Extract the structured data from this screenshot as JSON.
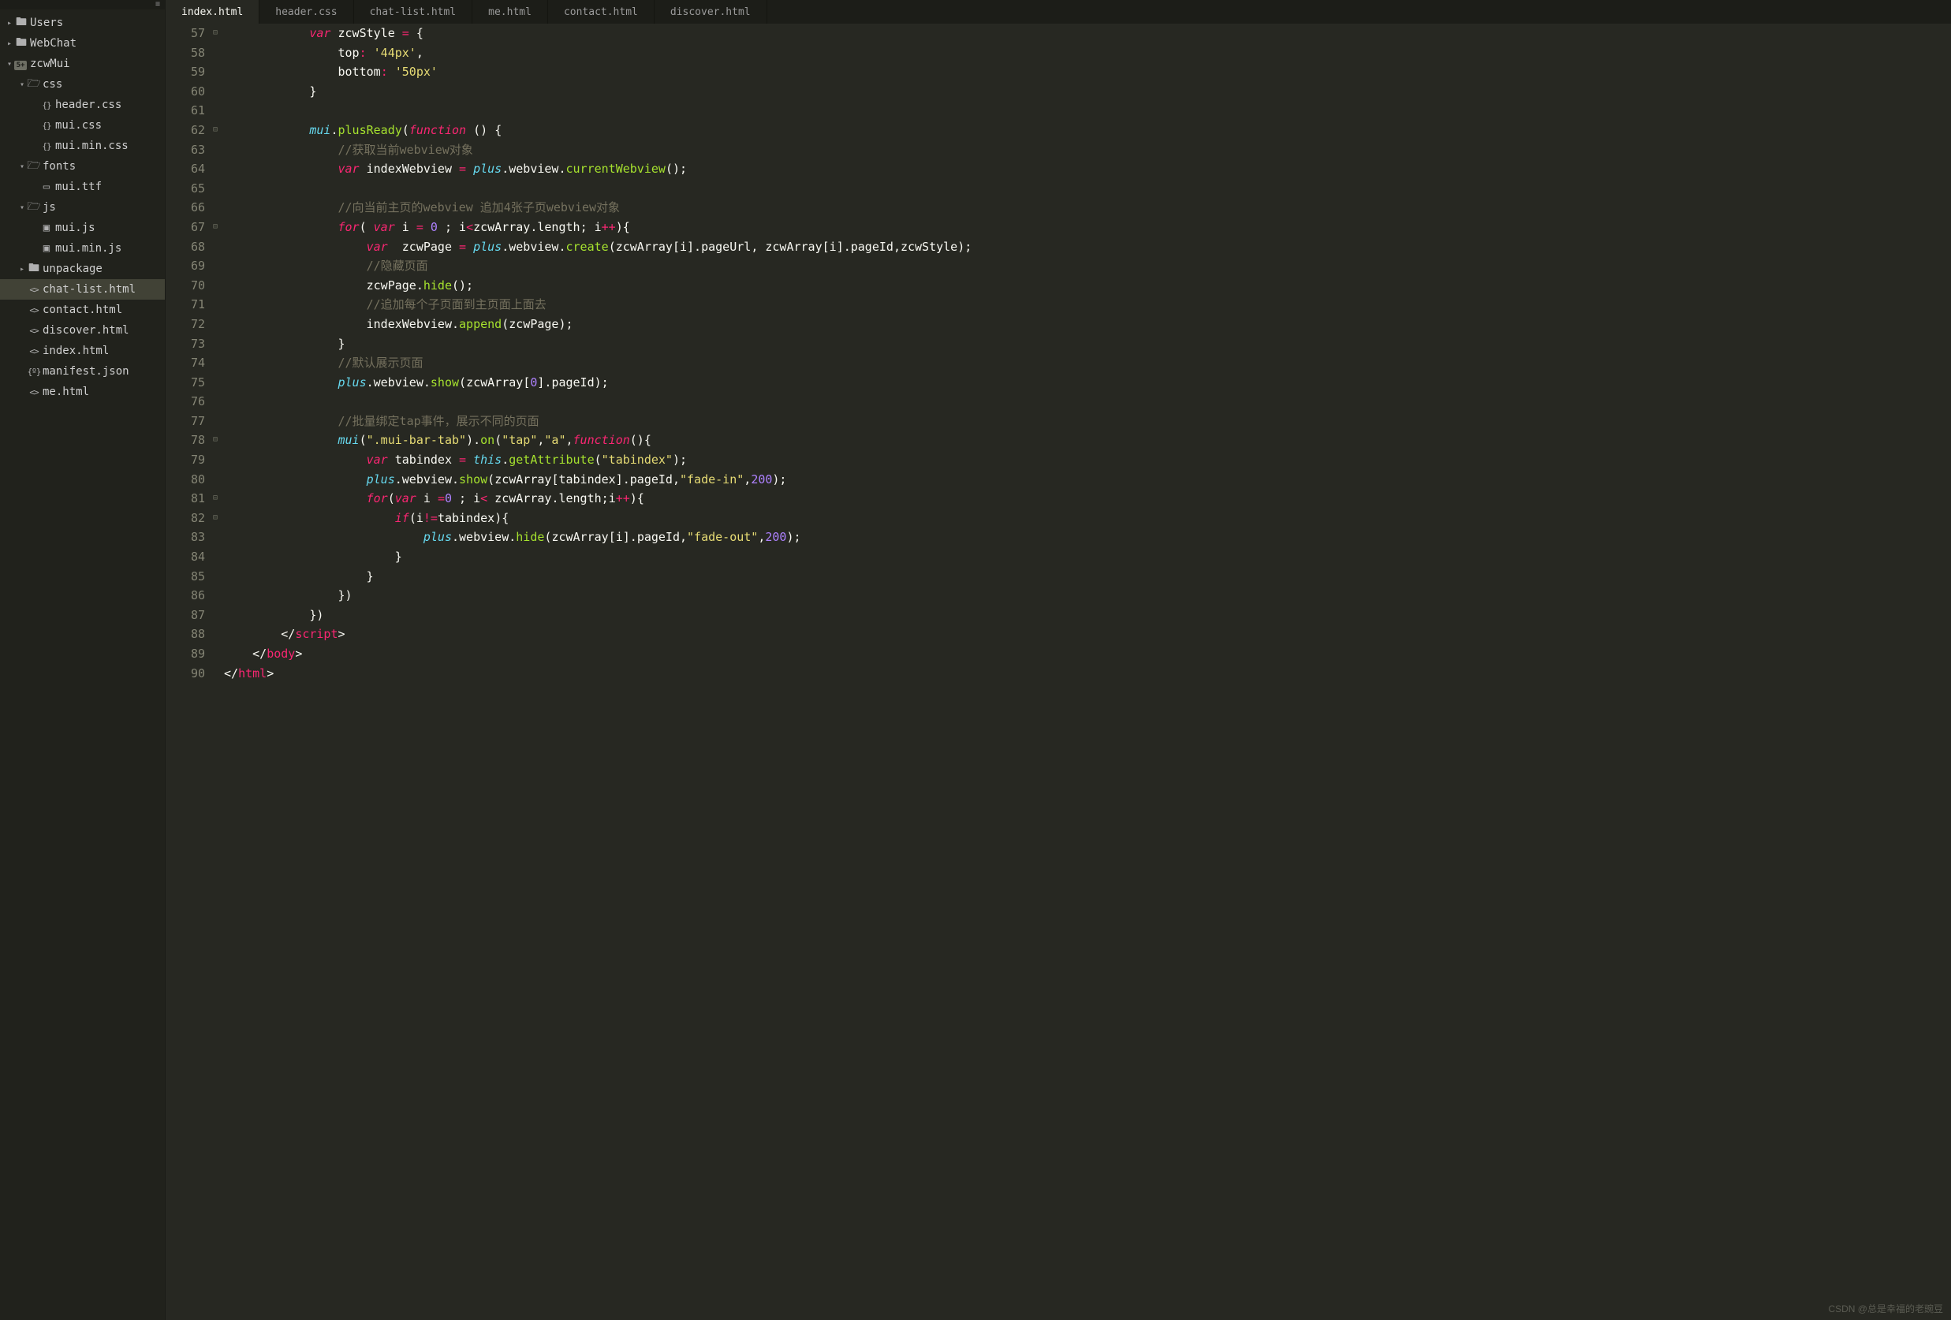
{
  "tabs": [
    {
      "label": "index.html",
      "active": true
    },
    {
      "label": "header.css",
      "active": false
    },
    {
      "label": "chat-list.html",
      "active": false
    },
    {
      "label": "me.html",
      "active": false
    },
    {
      "label": "contact.html",
      "active": false
    },
    {
      "label": "discover.html",
      "active": false
    }
  ],
  "tree": [
    {
      "depth": 1,
      "arrow": "right",
      "icon": "folder",
      "label": "Users",
      "selected": false
    },
    {
      "depth": 1,
      "arrow": "right",
      "icon": "folder",
      "label": "WebChat",
      "selected": false
    },
    {
      "depth": 1,
      "arrow": "down",
      "icon": "badge5",
      "label": "zcwMui",
      "selected": false
    },
    {
      "depth": 2,
      "arrow": "down",
      "icon": "folder-open",
      "label": "css",
      "selected": false
    },
    {
      "depth": 3,
      "arrow": "",
      "icon": "css",
      "label": "header.css",
      "selected": false
    },
    {
      "depth": 3,
      "arrow": "",
      "icon": "css",
      "label": "mui.css",
      "selected": false
    },
    {
      "depth": 3,
      "arrow": "",
      "icon": "css",
      "label": "mui.min.css",
      "selected": false
    },
    {
      "depth": 2,
      "arrow": "down",
      "icon": "folder-open",
      "label": "fonts",
      "selected": false
    },
    {
      "depth": 3,
      "arrow": "",
      "icon": "file",
      "label": "mui.ttf",
      "selected": false
    },
    {
      "depth": 2,
      "arrow": "down",
      "icon": "folder-open",
      "label": "js",
      "selected": false
    },
    {
      "depth": 3,
      "arrow": "",
      "icon": "js",
      "label": "mui.js",
      "selected": false
    },
    {
      "depth": 3,
      "arrow": "",
      "icon": "js",
      "label": "mui.min.js",
      "selected": false
    },
    {
      "depth": 2,
      "arrow": "right",
      "icon": "folder",
      "label": "unpackage",
      "selected": false
    },
    {
      "depth": 2,
      "arrow": "",
      "icon": "html",
      "label": "chat-list.html",
      "selected": true
    },
    {
      "depth": 2,
      "arrow": "",
      "icon": "html",
      "label": "contact.html",
      "selected": false
    },
    {
      "depth": 2,
      "arrow": "",
      "icon": "html",
      "label": "discover.html",
      "selected": false
    },
    {
      "depth": 2,
      "arrow": "",
      "icon": "html",
      "label": "index.html",
      "selected": false
    },
    {
      "depth": 2,
      "arrow": "",
      "icon": "json",
      "label": "manifest.json",
      "selected": false
    },
    {
      "depth": 2,
      "arrow": "",
      "icon": "html",
      "label": "me.html",
      "selected": false
    }
  ],
  "editor": {
    "first_line": 57,
    "lines": [
      {
        "n": 57,
        "fold": "⊟",
        "indent": 3,
        "tokens": [
          [
            "kw",
            "var"
          ],
          [
            "ident",
            " zcwStyle "
          ],
          [
            "op",
            "="
          ],
          [
            "ident",
            " "
          ],
          [
            "ocur",
            "{"
          ]
        ]
      },
      {
        "n": 58,
        "fold": "",
        "indent": 4,
        "tokens": [
          [
            "ident",
            "top"
          ],
          [
            "op",
            ":"
          ],
          [
            "ident",
            " "
          ],
          [
            "str",
            "'44px'"
          ],
          [
            "punct",
            ","
          ]
        ]
      },
      {
        "n": 59,
        "fold": "",
        "indent": 4,
        "tokens": [
          [
            "ident",
            "bottom"
          ],
          [
            "op",
            ":"
          ],
          [
            "ident",
            " "
          ],
          [
            "str",
            "'50px'"
          ]
        ]
      },
      {
        "n": 60,
        "fold": "",
        "indent": 3,
        "tokens": [
          [
            "ocur",
            "}"
          ]
        ]
      },
      {
        "n": 61,
        "fold": "",
        "indent": 0,
        "tokens": []
      },
      {
        "n": 62,
        "fold": "⊟",
        "indent": 3,
        "tokens": [
          [
            "obj",
            "mui"
          ],
          [
            "punct",
            "."
          ],
          [
            "fnname",
            "plusReady"
          ],
          [
            "punct",
            "("
          ],
          [
            "kw",
            "function"
          ],
          [
            "ident",
            " "
          ],
          [
            "punct",
            "()"
          ],
          [
            "ident",
            " "
          ],
          [
            "ocur",
            "{"
          ]
        ]
      },
      {
        "n": 63,
        "fold": "",
        "indent": 4,
        "tokens": [
          [
            "cm",
            "//获取当前webview对象"
          ]
        ]
      },
      {
        "n": 64,
        "fold": "",
        "indent": 4,
        "tokens": [
          [
            "kw",
            "var"
          ],
          [
            "ident",
            " indexWebview "
          ],
          [
            "op",
            "="
          ],
          [
            "ident",
            " "
          ],
          [
            "obj",
            "plus"
          ],
          [
            "punct",
            "."
          ],
          [
            "ident",
            "webview"
          ],
          [
            "punct",
            "."
          ],
          [
            "fnname",
            "currentWebview"
          ],
          [
            "punct",
            "();"
          ]
        ]
      },
      {
        "n": 65,
        "fold": "",
        "indent": 0,
        "tokens": []
      },
      {
        "n": 66,
        "fold": "",
        "indent": 4,
        "tokens": [
          [
            "cm",
            "//向当前主页的webview 追加4张子页webview对象"
          ]
        ]
      },
      {
        "n": 67,
        "fold": "⊟",
        "indent": 4,
        "tokens": [
          [
            "kw",
            "for"
          ],
          [
            "punct",
            "( "
          ],
          [
            "kw",
            "var"
          ],
          [
            "ident",
            " i "
          ],
          [
            "op",
            "="
          ],
          [
            "ident",
            " "
          ],
          [
            "num",
            "0"
          ],
          [
            "ident",
            " "
          ],
          [
            "punct",
            "; "
          ],
          [
            "ident",
            "i"
          ],
          [
            "op",
            "<"
          ],
          [
            "ident",
            "zcwArray"
          ],
          [
            "punct",
            "."
          ],
          [
            "ident",
            "length"
          ],
          [
            "punct",
            "; "
          ],
          [
            "ident",
            "i"
          ],
          [
            "op",
            "++"
          ],
          [
            "punct",
            ")"
          ],
          [
            "ocur",
            "{"
          ]
        ]
      },
      {
        "n": 68,
        "fold": "",
        "indent": 5,
        "tokens": [
          [
            "kw",
            "var"
          ],
          [
            "ident",
            "  zcwPage "
          ],
          [
            "op",
            "="
          ],
          [
            "ident",
            " "
          ],
          [
            "obj",
            "plus"
          ],
          [
            "punct",
            "."
          ],
          [
            "ident",
            "webview"
          ],
          [
            "punct",
            "."
          ],
          [
            "fnname",
            "create"
          ],
          [
            "punct",
            "("
          ],
          [
            "ident",
            "zcwArray"
          ],
          [
            "punct",
            "["
          ],
          [
            "ident",
            "i"
          ],
          [
            "punct",
            "]."
          ],
          [
            "ident",
            "pageUrl"
          ],
          [
            "punct",
            ", "
          ],
          [
            "ident",
            "zcwArray"
          ],
          [
            "punct",
            "["
          ],
          [
            "ident",
            "i"
          ],
          [
            "punct",
            "]."
          ],
          [
            "ident",
            "pageId"
          ],
          [
            "punct",
            ","
          ],
          [
            "ident",
            "zcwStyle"
          ],
          [
            "punct",
            ");"
          ]
        ]
      },
      {
        "n": 69,
        "fold": "",
        "indent": 5,
        "tokens": [
          [
            "cm",
            "//隐藏页面"
          ]
        ]
      },
      {
        "n": 70,
        "fold": "",
        "indent": 5,
        "tokens": [
          [
            "ident",
            "zcwPage"
          ],
          [
            "punct",
            "."
          ],
          [
            "fnname",
            "hide"
          ],
          [
            "punct",
            "();"
          ]
        ]
      },
      {
        "n": 71,
        "fold": "",
        "indent": 5,
        "tokens": [
          [
            "cm",
            "//追加每个子页面到主页面上面去"
          ]
        ]
      },
      {
        "n": 72,
        "fold": "",
        "indent": 5,
        "tokens": [
          [
            "ident",
            "indexWebview"
          ],
          [
            "punct",
            "."
          ],
          [
            "fnname",
            "append"
          ],
          [
            "punct",
            "("
          ],
          [
            "ident",
            "zcwPage"
          ],
          [
            "punct",
            ");"
          ]
        ]
      },
      {
        "n": 73,
        "fold": "",
        "indent": 4,
        "tokens": [
          [
            "ocur",
            "}"
          ]
        ]
      },
      {
        "n": 74,
        "fold": "",
        "indent": 4,
        "tokens": [
          [
            "cm",
            "//默认展示页面"
          ]
        ]
      },
      {
        "n": 75,
        "fold": "",
        "indent": 4,
        "tokens": [
          [
            "obj",
            "plus"
          ],
          [
            "punct",
            "."
          ],
          [
            "ident",
            "webview"
          ],
          [
            "punct",
            "."
          ],
          [
            "fnname",
            "show"
          ],
          [
            "punct",
            "("
          ],
          [
            "ident",
            "zcwArray"
          ],
          [
            "punct",
            "["
          ],
          [
            "num",
            "0"
          ],
          [
            "punct",
            "]."
          ],
          [
            "ident",
            "pageId"
          ],
          [
            "punct",
            ");"
          ]
        ]
      },
      {
        "n": 76,
        "fold": "",
        "indent": 0,
        "tokens": []
      },
      {
        "n": 77,
        "fold": "",
        "indent": 4,
        "tokens": [
          [
            "cm",
            "//批量绑定tap事件，展示不同的页面"
          ]
        ]
      },
      {
        "n": 78,
        "fold": "⊟",
        "indent": 4,
        "tokens": [
          [
            "obj",
            "mui"
          ],
          [
            "punct",
            "("
          ],
          [
            "str",
            "\".mui-bar-tab\""
          ],
          [
            "punct",
            ")."
          ],
          [
            "fnname",
            "on"
          ],
          [
            "punct",
            "("
          ],
          [
            "str",
            "\"tap\""
          ],
          [
            "punct",
            ","
          ],
          [
            "str",
            "\"a\""
          ],
          [
            "punct",
            ","
          ],
          [
            "kw",
            "function"
          ],
          [
            "punct",
            "()"
          ],
          [
            "ocur",
            "{"
          ]
        ]
      },
      {
        "n": 79,
        "fold": "",
        "indent": 5,
        "tokens": [
          [
            "kw",
            "var"
          ],
          [
            "ident",
            " tabindex "
          ],
          [
            "op",
            "="
          ],
          [
            "ident",
            " "
          ],
          [
            "obj",
            "this"
          ],
          [
            "punct",
            "."
          ],
          [
            "fnname",
            "getAttribute"
          ],
          [
            "punct",
            "("
          ],
          [
            "str",
            "\"tabindex\""
          ],
          [
            "punct",
            ");"
          ]
        ]
      },
      {
        "n": 80,
        "fold": "",
        "indent": 5,
        "tokens": [
          [
            "obj",
            "plus"
          ],
          [
            "punct",
            "."
          ],
          [
            "ident",
            "webview"
          ],
          [
            "punct",
            "."
          ],
          [
            "fnname",
            "show"
          ],
          [
            "punct",
            "("
          ],
          [
            "ident",
            "zcwArray"
          ],
          [
            "punct",
            "["
          ],
          [
            "ident",
            "tabindex"
          ],
          [
            "punct",
            "]."
          ],
          [
            "ident",
            "pageId"
          ],
          [
            "punct",
            ","
          ],
          [
            "str",
            "\"fade-in\""
          ],
          [
            "punct",
            ","
          ],
          [
            "num",
            "200"
          ],
          [
            "punct",
            ");"
          ]
        ]
      },
      {
        "n": 81,
        "fold": "⊟",
        "indent": 5,
        "tokens": [
          [
            "kw",
            "for"
          ],
          [
            "punct",
            "("
          ],
          [
            "kw",
            "var"
          ],
          [
            "ident",
            " i "
          ],
          [
            "op",
            "="
          ],
          [
            "num",
            "0"
          ],
          [
            "ident",
            " "
          ],
          [
            "punct",
            "; "
          ],
          [
            "ident",
            "i"
          ],
          [
            "op",
            "<"
          ],
          [
            "ident",
            " zcwArray"
          ],
          [
            "punct",
            "."
          ],
          [
            "ident",
            "length"
          ],
          [
            "punct",
            ";"
          ],
          [
            "ident",
            "i"
          ],
          [
            "op",
            "++"
          ],
          [
            "punct",
            ")"
          ],
          [
            "ocur",
            "{"
          ]
        ]
      },
      {
        "n": 82,
        "fold": "⊟",
        "indent": 6,
        "tokens": [
          [
            "kw",
            "if"
          ],
          [
            "punct",
            "("
          ],
          [
            "ident",
            "i"
          ],
          [
            "op",
            "!="
          ],
          [
            "ident",
            "tabindex"
          ],
          [
            "punct",
            ")"
          ],
          [
            "ocur",
            "{"
          ]
        ]
      },
      {
        "n": 83,
        "fold": "",
        "indent": 7,
        "tokens": [
          [
            "obj",
            "plus"
          ],
          [
            "punct",
            "."
          ],
          [
            "ident",
            "webview"
          ],
          [
            "punct",
            "."
          ],
          [
            "fnname",
            "hide"
          ],
          [
            "punct",
            "("
          ],
          [
            "ident",
            "zcwArray"
          ],
          [
            "punct",
            "["
          ],
          [
            "ident",
            "i"
          ],
          [
            "punct",
            "]."
          ],
          [
            "ident",
            "pageId"
          ],
          [
            "punct",
            ","
          ],
          [
            "str",
            "\"fade-out\""
          ],
          [
            "punct",
            ","
          ],
          [
            "num",
            "200"
          ],
          [
            "punct",
            ");"
          ]
        ]
      },
      {
        "n": 84,
        "fold": "",
        "indent": 6,
        "tokens": [
          [
            "ocur",
            "}"
          ]
        ]
      },
      {
        "n": 85,
        "fold": "",
        "indent": 5,
        "tokens": [
          [
            "ocur",
            "}"
          ]
        ]
      },
      {
        "n": 86,
        "fold": "",
        "indent": 4,
        "tokens": [
          [
            "ocur",
            "}"
          ],
          [
            "punct",
            ")"
          ]
        ]
      },
      {
        "n": 87,
        "fold": "",
        "indent": 3,
        "tokens": [
          [
            "ocur",
            "}"
          ],
          [
            "punct",
            ")"
          ]
        ]
      },
      {
        "n": 88,
        "fold": "",
        "indent": 2,
        "tokens": [
          [
            "tagb",
            "</"
          ],
          [
            "tag",
            "script"
          ],
          [
            "tagb",
            ">"
          ]
        ]
      },
      {
        "n": 89,
        "fold": "",
        "indent": 1,
        "tokens": [
          [
            "tagb",
            "</"
          ],
          [
            "tag",
            "body"
          ],
          [
            "tagb",
            ">"
          ]
        ]
      },
      {
        "n": 90,
        "fold": "",
        "indent": 0,
        "tokens": [
          [
            "tagb",
            "</"
          ],
          [
            "tag",
            "html"
          ],
          [
            "tagb",
            ">"
          ]
        ]
      }
    ]
  },
  "watermark": "CSDN @总是幸福的老豌豆",
  "icon_glyphs": {
    "folder": "🖿",
    "folder-open": "🗁",
    "file": "▭",
    "css": "{}",
    "js": "▣",
    "html": "<>",
    "json": "{º}"
  },
  "badge5_text": "5+"
}
